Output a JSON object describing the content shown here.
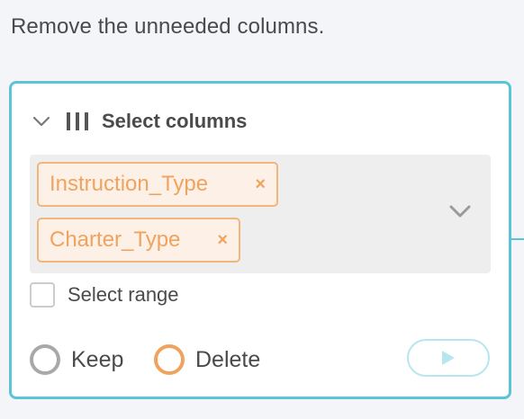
{
  "instruction": "Remove the unneeded columns.",
  "block": {
    "title": "Select columns",
    "header_icon": "columns-icon",
    "collapse_icon": "chevron-down-icon",
    "selected_columns": [
      {
        "label": "Instruction_Type",
        "remove": "×"
      },
      {
        "label": "Charter_Type",
        "remove": "×"
      }
    ],
    "dropdown_icon": "chevron-down-icon",
    "select_range": {
      "label": "Select range",
      "checked": false
    },
    "mode": {
      "options": [
        {
          "label": "Keep",
          "selected": false
        },
        {
          "label": "Delete",
          "selected": true
        }
      ]
    },
    "run_button": {
      "icon": "play-icon"
    }
  },
  "colors": {
    "accent_border": "#5bc4d8",
    "tag_border": "#f2b57b",
    "tag_background": "#fdf1e7",
    "tag_text": "#f0a35e",
    "text": "#4a4a4a",
    "run_icon": "#b7e6ef"
  }
}
